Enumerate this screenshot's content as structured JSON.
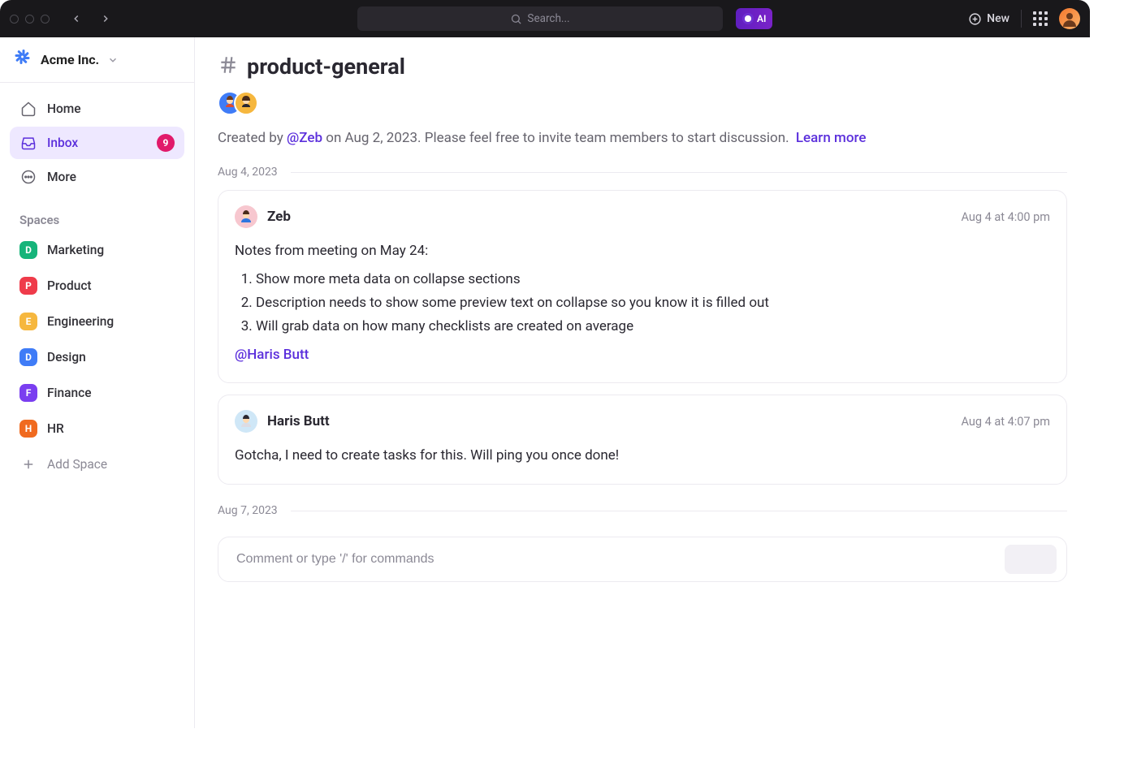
{
  "titlebar": {
    "search_placeholder": "Search...",
    "ai_label": "AI",
    "new_label": "New"
  },
  "workspace": {
    "name": "Acme Inc."
  },
  "nav": {
    "home": "Home",
    "inbox": "Inbox",
    "inbox_count": "9",
    "more": "More"
  },
  "spaces": {
    "label": "Spaces",
    "items": [
      {
        "letter": "D",
        "name": "Marketing",
        "color": "#16b47a"
      },
      {
        "letter": "P",
        "name": "Product",
        "color": "#ef3b4a"
      },
      {
        "letter": "E",
        "name": "Engineering",
        "color": "#f6b73e"
      },
      {
        "letter": "D",
        "name": "Design",
        "color": "#3f7cf7"
      },
      {
        "letter": "F",
        "name": "Finance",
        "color": "#7a3ef0"
      },
      {
        "letter": "H",
        "name": "HR",
        "color": "#f06a1f"
      }
    ],
    "add_label": "Add Space"
  },
  "channel": {
    "name": "product-general",
    "created_prefix": "Created by ",
    "created_mention": "@Zeb",
    "created_suffix": " on Aug 2, 2023. Please feel free to invite team members to start discussion. ",
    "learn_more": "Learn more"
  },
  "days": [
    {
      "label": "Aug 4, 2023"
    },
    {
      "label": "Aug 7, 2023"
    }
  ],
  "messages": [
    {
      "author": "Zeb",
      "time": "Aug 4 at 4:00 pm",
      "intro": "Notes from meeting on May 24:",
      "list": [
        "Show more meta data on collapse sections",
        "Description needs to show some preview text on collapse so you know it is filled out",
        "Will grab data on how many checklists are created on average"
      ],
      "mention": "@Haris Butt"
    },
    {
      "author": "Haris Butt",
      "time": "Aug 4 at 4:07 pm",
      "text": "Gotcha, I need to create tasks for this. Will ping you once done!"
    }
  ],
  "composer": {
    "placeholder": "Comment or type '/' for commands"
  }
}
